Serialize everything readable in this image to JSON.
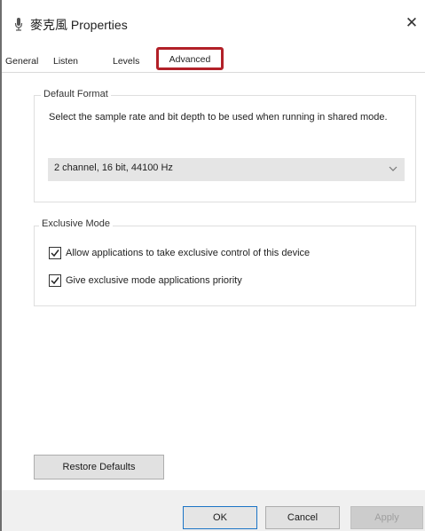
{
  "window": {
    "title": "麥克風 Properties",
    "close_glyph": "✕"
  },
  "tabs": [
    {
      "label": "General",
      "selected": false
    },
    {
      "label": "Listen",
      "selected": false
    },
    {
      "label": "Levels",
      "selected": false
    },
    {
      "label": "Advanced",
      "selected": true
    }
  ],
  "default_format": {
    "group_label": "Default Format",
    "description": "Select the sample rate and bit depth to be used when running in shared mode.",
    "selected_format": "2 channel, 16 bit, 44100 Hz"
  },
  "exclusive_mode": {
    "group_label": "Exclusive Mode",
    "options": [
      {
        "label": "Allow applications to take exclusive control of this device",
        "checked": true
      },
      {
        "label": "Give exclusive mode applications priority",
        "checked": true
      }
    ]
  },
  "buttons": {
    "restore_defaults": "Restore Defaults",
    "ok": "OK",
    "cancel": "Cancel",
    "apply": "Apply"
  },
  "colors": {
    "highlight_box": "#b22028",
    "default_button_border": "#1c74c6"
  },
  "icons": {
    "title_icon": "microphone-icon",
    "dropdown_icon": "chevron-down-icon"
  }
}
